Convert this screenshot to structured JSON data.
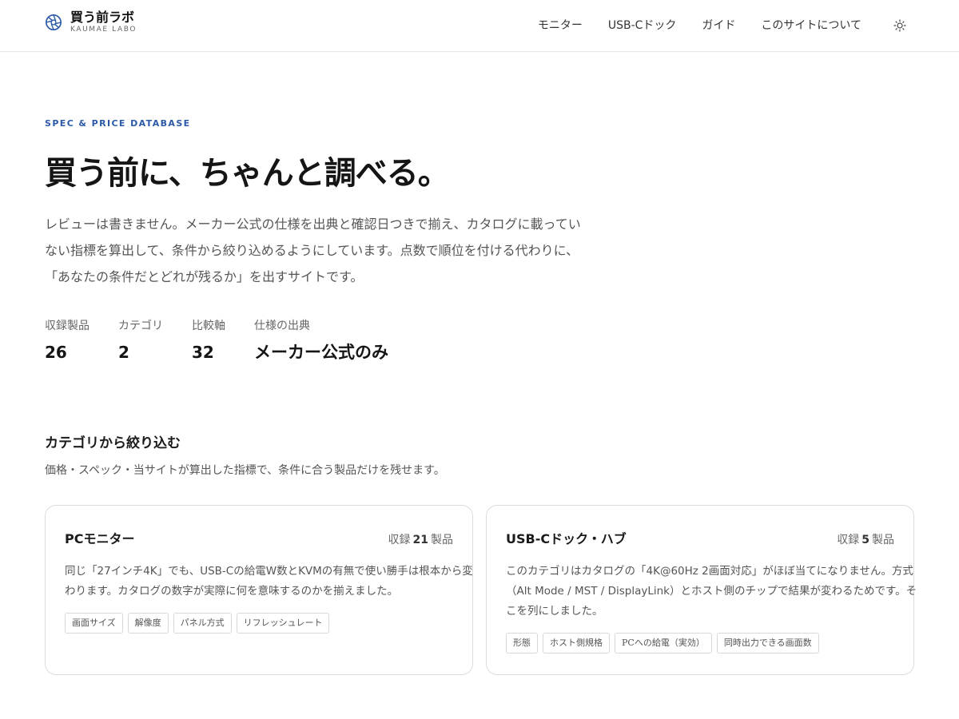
{
  "brand": {
    "name": "買う前ラボ",
    "sub": "KAUMAE LABO"
  },
  "nav": {
    "items": [
      {
        "label": "モニター"
      },
      {
        "label": "USB-Cドック"
      },
      {
        "label": "ガイド"
      },
      {
        "label": "このサイトについて"
      }
    ]
  },
  "hero": {
    "eyebrow": "SPEC & PRICE DATABASE",
    "title": "買う前に、ちゃんと調べる。",
    "desc_lines": [
      "レビューは書きません。メーカー公式の仕様を出典と確認日つきで揃え、カタログに載ってい",
      "ない指標を算出して、条件から絞り込めるようにしています。点数で順位を付ける代わりに、",
      "「あなたの条件だとどれが残るか」を出すサイトです。"
    ]
  },
  "stats": [
    {
      "label": "収録製品",
      "value": "26"
    },
    {
      "label": "カテゴリ",
      "value": "2"
    },
    {
      "label": "比較軸",
      "value": "32"
    },
    {
      "label": "仕様の出典",
      "value": "メーカー公式のみ"
    }
  ],
  "section": {
    "title": "カテゴリから絞り込む",
    "desc": "価格・スペック・当サイトが算出した指標で、条件に合う製品だけを残せます。"
  },
  "cards": [
    {
      "title": "PCモニター",
      "count_prefix": "収録",
      "count": "21",
      "count_suffix": "製品",
      "desc_lines": [
        "同じ「27インチ4K」でも、USB-Cの給電W数とKVMの有無で使い勝手は根本から変",
        "わります。カタログの数字が実際に何を意味するのかを揃えました。"
      ],
      "tags": [
        "画面サイズ",
        "解像度",
        "パネル方式",
        "リフレッシュレート"
      ]
    },
    {
      "title": "USB-Cドック・ハブ",
      "count_prefix": "収録",
      "count": "5",
      "count_suffix": "製品",
      "desc_lines": [
        "このカテゴリはカタログの「4K@60Hz 2画面対応」がほぼ当てになりません。方式",
        "（Alt Mode / MST / DisplayLink）とホスト側のチップで結果が変わるためです。そ",
        "こを列にしました。"
      ],
      "tags": [
        "形態",
        "ホスト側規格",
        "PCへの給電（実効）",
        "同時出力できる画面数"
      ]
    }
  ],
  "colors": {
    "accent": "#2b5aa8",
    "border": "#dcdcdc"
  }
}
